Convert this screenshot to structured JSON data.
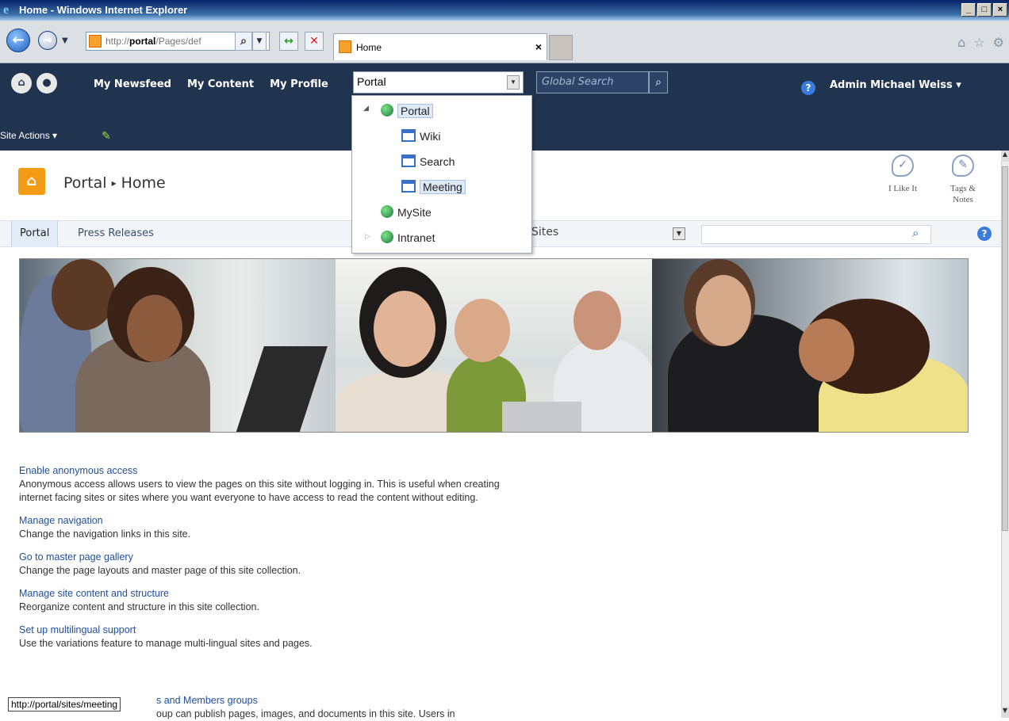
{
  "window": {
    "title": "Home - Windows Internet Explorer",
    "controls": [
      "_",
      "□",
      "×"
    ]
  },
  "browser": {
    "address_prefix": "http://",
    "address_host": "portal",
    "address_rest": "/Pages/def",
    "tab_label": "Home",
    "tab_close": "×"
  },
  "topbar": {
    "links": [
      "My Newsfeed",
      "My Content",
      "My Profile"
    ],
    "scope_value": "Portal",
    "global_search_placeholder": "Global Search",
    "user": "Admin Michael Weiss ▾",
    "site_actions": "Site Actions ▾"
  },
  "scope_menu": {
    "items": [
      {
        "label": "Portal",
        "icon": "globe-icon",
        "level": 0,
        "expanded": true,
        "highlighted": true
      },
      {
        "label": "Wiki",
        "icon": "sitemap-icon",
        "level": 1
      },
      {
        "label": "Search",
        "icon": "sitemap-icon",
        "level": 1
      },
      {
        "label": "Meeting",
        "icon": "sitemap-icon",
        "level": 1,
        "highlighted": true
      },
      {
        "label": "MySite",
        "icon": "globe-icon",
        "level": 0
      },
      {
        "label": "Intranet",
        "icon": "globe-icon",
        "level": 0,
        "collapsed": true
      }
    ]
  },
  "title_area": {
    "site": "Portal",
    "separator": "▸",
    "page": "Home",
    "like_label": "I Like It",
    "tags_label": "Tags &",
    "tags_label2": "Notes"
  },
  "nav": {
    "items": [
      "Portal",
      "Press Releases"
    ],
    "search_scope": "Sites"
  },
  "content": {
    "items": [
      {
        "title": "Enable anonymous access",
        "desc": "Anonymous access allows users to view the pages on this site without logging in. This is useful when creating internet facing sites or sites where you want everyone to have access to read the content without editing."
      },
      {
        "title": "Manage navigation",
        "desc": "Change the navigation links in this site."
      },
      {
        "title": "Go to master page gallery",
        "desc": "Change the page layouts and master page of this site collection."
      },
      {
        "title": "Manage site content and structure",
        "desc": "Reorganize content and structure in this site collection."
      },
      {
        "title": "Set up multilingual support",
        "desc": "Use the variations feature to manage multi-lingual sites and pages."
      }
    ],
    "partial_title": "s and Members groups",
    "partial_desc": "oup can publish pages, images, and documents in this site. Users in"
  },
  "status_url": "http://portal/sites/meeting",
  "colors": {
    "sp_bar": "#21344f",
    "link": "#1f4e9e",
    "accent": "#f49b16"
  }
}
